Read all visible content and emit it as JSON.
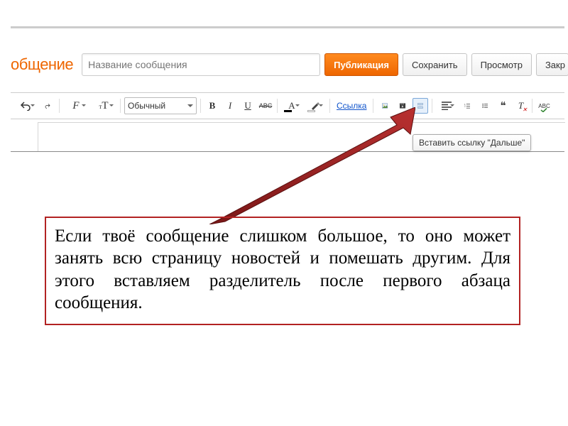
{
  "header": {
    "title_fragment": "общение",
    "input_placeholder": "Название сообщения",
    "publish": "Публикация",
    "save": "Сохранить",
    "preview": "Просмотр",
    "close": "Закр"
  },
  "toolbar": {
    "style_select": "Обычный",
    "bold": "B",
    "italic": "I",
    "underline": "U",
    "strike": "ABC",
    "text_color": "A",
    "link_label": "Ссылка",
    "quote": "❝",
    "remove_format": "T",
    "spellcheck": "ABC"
  },
  "tooltip": "Вставить ссылку \"Дальше\"",
  "annotation": "Если твоё сообщение слишком большое, то оно может занять всю страницу новостей и помешать другим. Для этого вставляем разделитель после первого абзаца сообщения."
}
